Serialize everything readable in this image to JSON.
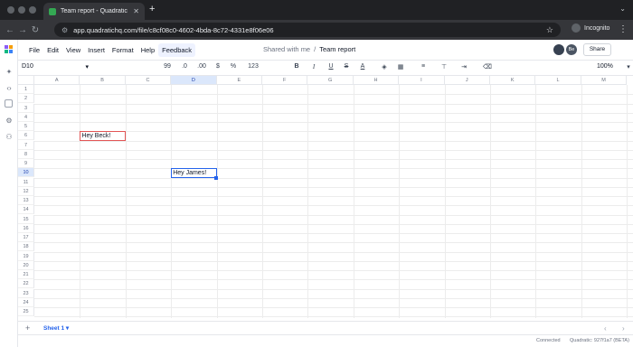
{
  "browser": {
    "tab_title": "Team report - Quadratic",
    "url": "app.quadratichq.com/file/c8cf08c0-4602-4bda-8c72-4331e8f06e06",
    "incognito_label": "Incognito"
  },
  "menu": {
    "items": [
      "File",
      "Edit",
      "View",
      "Insert",
      "Format",
      "Help",
      "Feedback"
    ],
    "active": "Feedback"
  },
  "breadcrumb": {
    "parent": "Shared with me",
    "separator": "/",
    "current": "Team report"
  },
  "header": {
    "avatar_initials": "Be",
    "share_label": "Share"
  },
  "toolbar": {
    "cell_ref": "D10",
    "quote": "99",
    "dec_less": ".0",
    "dec_more": ".00",
    "currency": "$",
    "percent": "%",
    "number_format": "123",
    "bold": "B",
    "italic": "I",
    "underline": "U",
    "strike": "S",
    "text_color": "A",
    "zoom": "100%"
  },
  "grid": {
    "columns": [
      "A",
      "B",
      "C",
      "D",
      "E",
      "F",
      "G",
      "H",
      "I",
      "J",
      "K",
      "L",
      "M"
    ],
    "selected_column": "D",
    "rows": [
      "1",
      "2",
      "3",
      "4",
      "5",
      "6",
      "7",
      "8",
      "9",
      "10",
      "11",
      "12",
      "13",
      "14",
      "15",
      "16",
      "17",
      "18",
      "19",
      "20",
      "21",
      "22",
      "23",
      "24",
      "25"
    ],
    "selected_row": "10",
    "cells": {
      "B6": "Hey Beck!",
      "D10": "Hey James!"
    }
  },
  "sheets": {
    "active": "Sheet 1"
  },
  "status": {
    "connection": "Connected",
    "version": "Quadratic: 927f1a7 (BETA)"
  },
  "colors": {
    "accent": "#2563eb",
    "comment_border": "#e25555"
  }
}
